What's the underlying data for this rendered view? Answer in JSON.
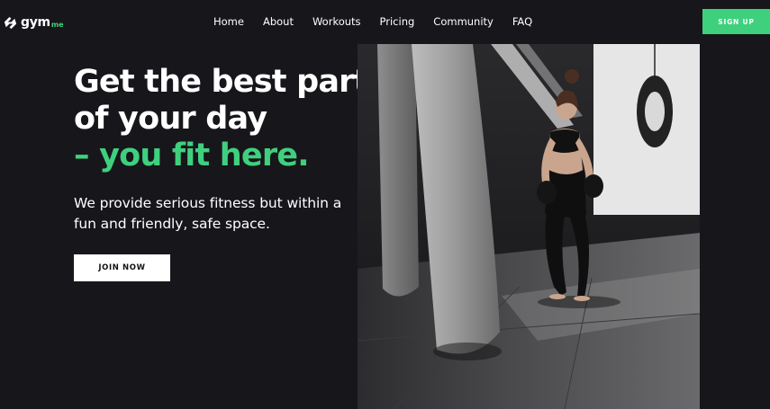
{
  "brand": {
    "name": "gym",
    "suffix": "me",
    "logo_icon": "bolt-mark-icon"
  },
  "nav": {
    "items": [
      "Home",
      "About",
      "Workouts",
      "Pricing",
      "Community",
      "FAQ"
    ]
  },
  "header": {
    "signup_label": "SIGN UP"
  },
  "hero": {
    "headline_line1": "Get the best part",
    "headline_line2": "of your day",
    "headline_accent": "– you fit here.",
    "subtext": "We provide serious fitness but within a fun and friendly, safe space.",
    "cta_label": "JOIN NOW",
    "image": "boxer-with-punching-bags-photo"
  },
  "colors": {
    "accent": "#3fd07e",
    "background": "#17161b",
    "text": "#ffffff"
  }
}
